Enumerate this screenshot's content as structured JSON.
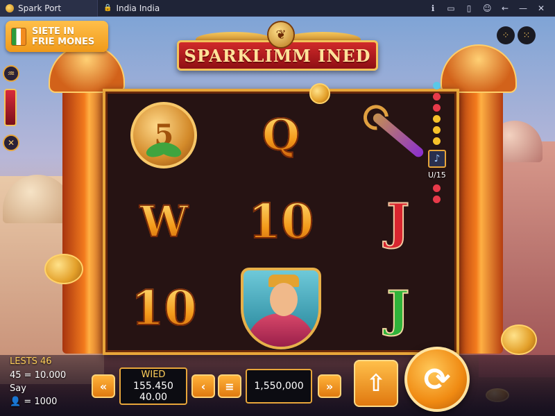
{
  "browser": {
    "tab_title": "Spark Port",
    "second_tab_title": "India India",
    "controls": [
      "ℹ",
      "▭",
      "▯",
      "☺",
      "←",
      "—",
      "✕"
    ]
  },
  "promo": {
    "line1": "SIETE IN",
    "line2": "FRIE MONES"
  },
  "game": {
    "title": "SPARKLIMM INED",
    "reels": [
      [
        {
          "type": "coin-medal",
          "text": "5"
        },
        {
          "type": "letter",
          "text": "Q"
        },
        {
          "type": "wand",
          "text": ""
        }
      ],
      [
        {
          "type": "letter",
          "text": "W"
        },
        {
          "type": "letter",
          "text": "10"
        },
        {
          "type": "j-red",
          "text": "J"
        }
      ],
      [
        {
          "type": "letter",
          "text": "10"
        },
        {
          "type": "portrait",
          "text": ""
        },
        {
          "type": "j-green",
          "text": "J"
        }
      ]
    ],
    "scatter_count": "U/15"
  },
  "hud": {
    "stat_lines": "LESTS 46",
    "stat_balance": "45 = 10.000",
    "stat_say": "Say",
    "stat_coins": "= 1000",
    "win_label": "WIED",
    "win_value_1": "155.450",
    "win_value_2": "40.00",
    "total_value": "1,550,000"
  },
  "colors": {
    "accent_gold": "#e8a63a",
    "title_red": "#d12a2a",
    "spin_orange": "#f08a12"
  }
}
